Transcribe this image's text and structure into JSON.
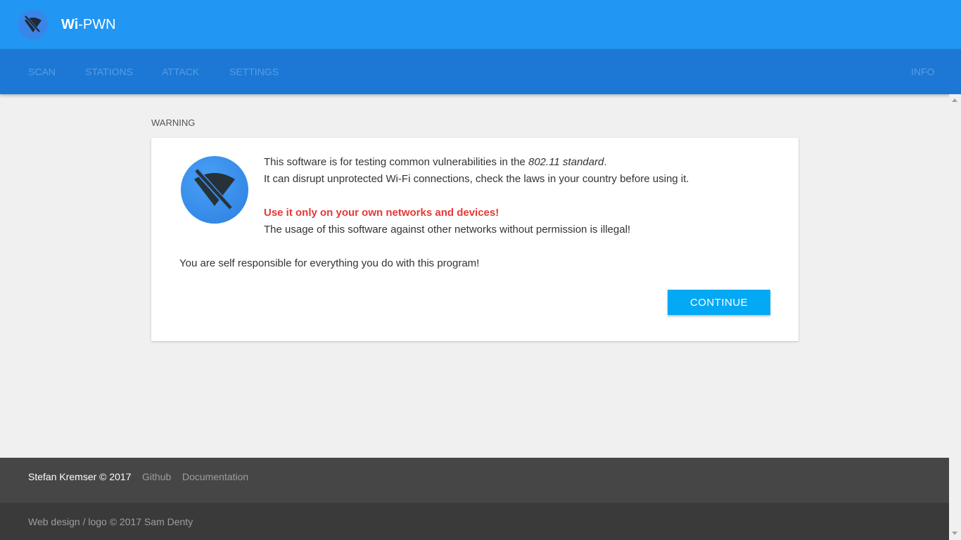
{
  "app": {
    "brand_bold": "Wi",
    "brand_rest": "-PWN",
    "logo_icon": "wifi-off-icon"
  },
  "nav": {
    "items": [
      {
        "label": "SCAN"
      },
      {
        "label": "STATIONS"
      },
      {
        "label": "ATTACK"
      },
      {
        "label": "SETTINGS"
      }
    ],
    "right_item": {
      "label": "INFO"
    }
  },
  "main": {
    "section_title": "WARNING",
    "card": {
      "line1_prefix": "This software is for testing common vulnerabilities in the ",
      "line1_italic": "802.11 standard",
      "line1_suffix": ".",
      "line2": "It can disrupt unprotected Wi-Fi connections, check the laws in your country before using it.",
      "warning": "Use it only on your own networks and devices!",
      "line3": "The usage of this software against other networks without permission is illegal!",
      "line4": "You are self responsible for everything you do with this program!",
      "continue_label": "CONTINUE"
    }
  },
  "footer": {
    "copyright": "Stefan Kremser © 2017",
    "links": [
      {
        "label": "Github"
      },
      {
        "label": "Documentation"
      }
    ],
    "design_credit": "Web design / logo © 2017 Sam Denty"
  },
  "colors": {
    "header": "#2196f3",
    "navbar": "#1c78d4",
    "accent_button": "#03a9f4",
    "warning_text": "#e53935",
    "footer_top": "#464646",
    "footer_bottom": "#3a3a3a"
  }
}
